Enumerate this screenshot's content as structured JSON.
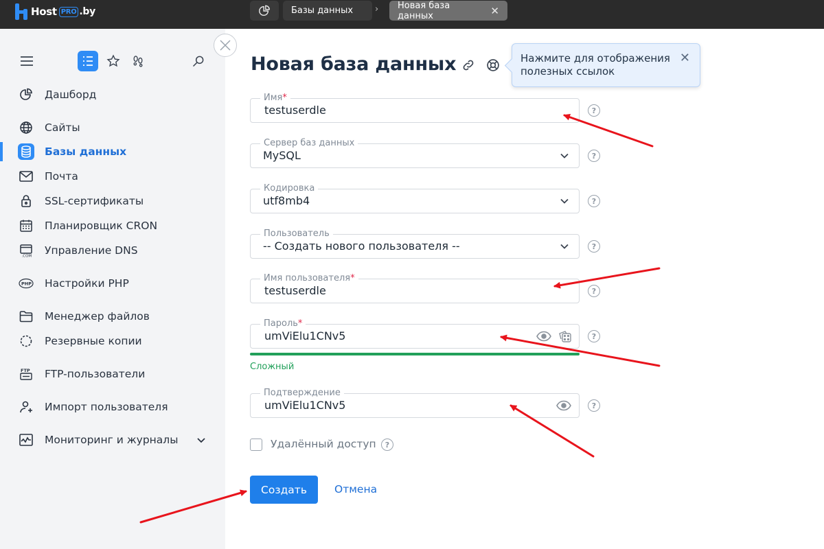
{
  "brand": {
    "name": "Host",
    "pro": "PRO",
    "suffix": ".by"
  },
  "breadcrumbs": [
    {
      "label": "Базы данных"
    },
    {
      "label": "Новая база данных",
      "close": "✕"
    }
  ],
  "sidebar": {
    "items": [
      {
        "label": "Дашборд",
        "icon": "pie-chart-icon"
      },
      {
        "label": "Сайты",
        "icon": "globe-icon"
      },
      {
        "label": "Базы данных",
        "icon": "database-icon",
        "active": true
      },
      {
        "label": "Почта",
        "icon": "mail-icon"
      },
      {
        "label": "SSL-сертификаты",
        "icon": "lock-icon"
      },
      {
        "label": "Планировщик CRON",
        "icon": "calendar-icon"
      },
      {
        "label": "Управление DNS",
        "icon": "dns-icon"
      },
      {
        "label": "Настройки PHP",
        "icon": "php-icon"
      },
      {
        "label": "Менеджер файлов",
        "icon": "folder-icon"
      },
      {
        "label": "Резервные копии",
        "icon": "backup-icon"
      },
      {
        "label": "FTP-пользователи",
        "icon": "ftp-icon"
      },
      {
        "label": "Импорт пользователя",
        "icon": "user-import-icon"
      },
      {
        "label": "Мониторинг и журналы",
        "icon": "monitoring-icon"
      }
    ]
  },
  "page": {
    "title": "Новая база данных"
  },
  "tooltip": {
    "text": "Нажмите для отображения полезных ссылок",
    "close": "✕"
  },
  "form": {
    "name": {
      "label": "Имя",
      "required": "*",
      "value": "testuserdle"
    },
    "db_server": {
      "label": "Сервер баз данных",
      "value": "MySQL"
    },
    "encoding": {
      "label": "Кодировка",
      "value": "utf8mb4"
    },
    "user": {
      "label": "Пользователь",
      "value": "-- Создать нового пользователя --"
    },
    "username": {
      "label": "Имя пользователя",
      "required": "*",
      "value": "testuserdle"
    },
    "password": {
      "label": "Пароль",
      "required": "*",
      "value": "umViElu1CNv5",
      "strength": "Сложный"
    },
    "confirm": {
      "label": "Подтверждение",
      "value": "umViElu1CNv5"
    },
    "remote_access": {
      "label": "Удалённый доступ",
      "checked": false
    },
    "help": "?"
  },
  "actions": {
    "create": "Создать",
    "cancel": "Отмена"
  },
  "colors": {
    "accent": "#1f7fea",
    "success": "#22a05a",
    "annotation": "#e8141c",
    "topbar": "#2b2b2b"
  }
}
